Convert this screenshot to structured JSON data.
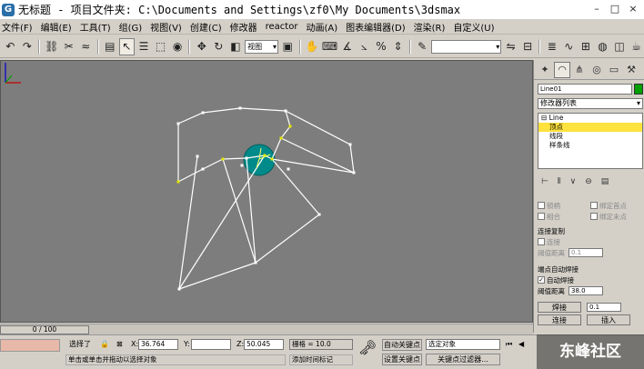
{
  "window": {
    "icon_label": "G",
    "title": "无标题   - 项目文件夹: C:\\Documents and Settings\\zf0\\My Documents\\3dsmax",
    "controls": [
      "–",
      "□",
      "×"
    ]
  },
  "menu": [
    "文件(F)",
    "编辑(E)",
    "工具(T)",
    "组(G)",
    "视图(V)",
    "创建(C)",
    "修改器",
    "reactor",
    "动画(A)",
    "图表编辑器(D)",
    "渲染(R)",
    "自定义(U)"
  ],
  "toolbar": {
    "coord_select": "视图",
    "named_selection": ""
  },
  "panel": {
    "object_name": "Line01",
    "object_color": "#00a000",
    "modifier_list": "修改器列表",
    "stack": {
      "root": "Line",
      "items": [
        "顶点",
        "线段",
        "样条线"
      ],
      "selected": "顶点"
    },
    "checks": {
      "lock_handles": "锁柄",
      "bind_first": "绑定首点",
      "relocate": "相合",
      "bind_last": "绑定末点"
    },
    "connect_copy": {
      "title": "连接复制",
      "connect": "连接",
      "threshold_label": "阈值距离",
      "threshold_value": "0.1"
    },
    "end_weld": {
      "title": "端点自动焊接",
      "auto_weld": "自动焊接",
      "threshold_label": "阈值距离",
      "threshold_value": "38.0"
    },
    "buttons": {
      "weld": "焊接",
      "weld_value": "0.1",
      "connect": "连接",
      "insert": "插入"
    }
  },
  "timeline": {
    "frame": "0 / 100"
  },
  "status": {
    "selected": "选择了",
    "x_label": "X:",
    "x_value": "36.764",
    "y_label": "Y:",
    "y_value": "",
    "z_label": "Z:",
    "z_value": "50.045",
    "grid": "栅格 = 10.0",
    "auto_key": "自动关键点",
    "selected_obj": "选定对象",
    "set_key": "设置关键点",
    "key_filters": "关键点过滤器...",
    "prompt": "单击或单击并拖动以选择对象",
    "add_time_tag": "添加时间标记"
  },
  "watermark": {
    "text": "东峰社区"
  },
  "colors": {
    "viewport_bg": "#7d7d7d",
    "spline_line": "#ffffff",
    "selected_vertex": "#e6e600",
    "brush_circle": "#008a8a",
    "panel_bg": "#d4d0c8",
    "stack_highlight": "#ffe23d"
  }
}
